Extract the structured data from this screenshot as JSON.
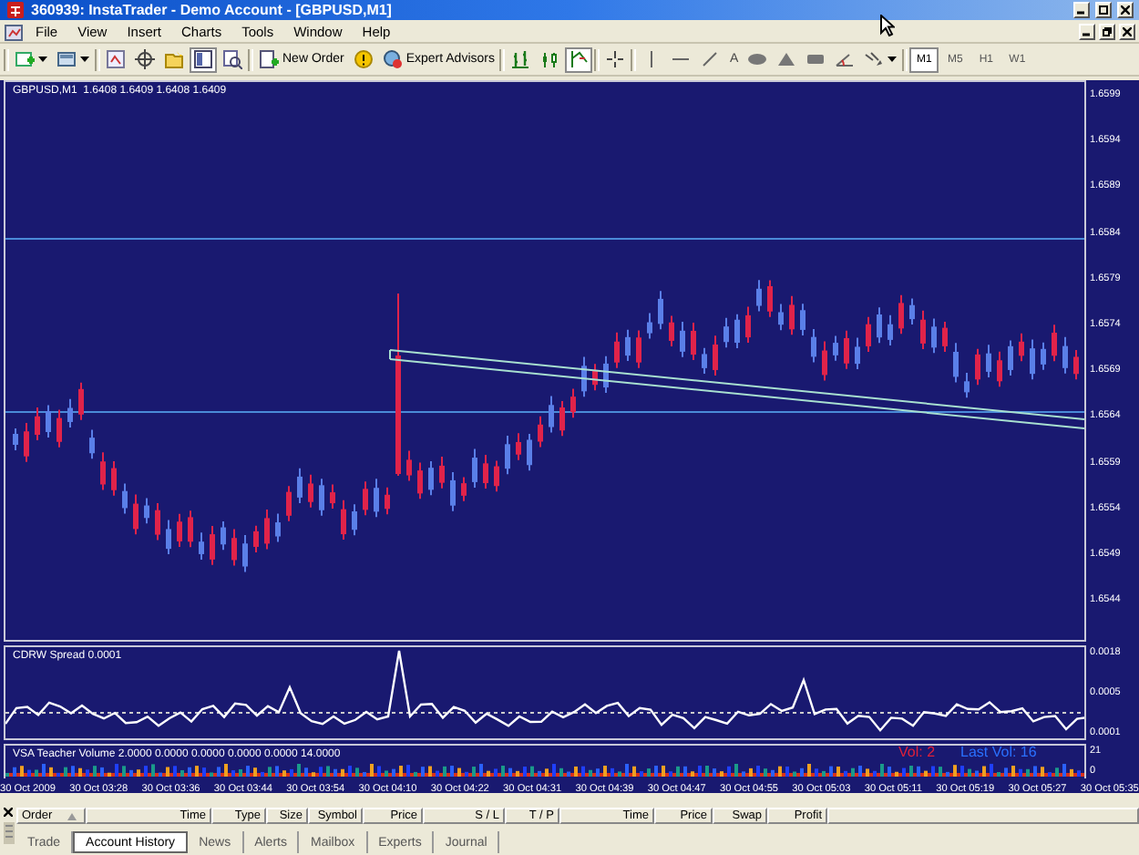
{
  "window": {
    "title": "360939: InstaTrader - Demo Account - [GBPUSD,M1]"
  },
  "menu": [
    "File",
    "View",
    "Insert",
    "Charts",
    "Tools",
    "Window",
    "Help"
  ],
  "toolbar": {
    "new_order": "New Order",
    "expert_advisors": "Expert Advisors",
    "text_tool": "A",
    "timeframes": [
      {
        "label": "M1",
        "selected": true
      },
      {
        "label": "M5",
        "selected": false
      },
      {
        "label": "H1",
        "selected": false
      },
      {
        "label": "W1",
        "selected": false
      }
    ]
  },
  "chart": {
    "legend": "GBPUSD,M1  1.6408 1.6409 1.6408 1.6409",
    "price_axis": [
      "1.6599",
      "1.6594",
      "1.6589",
      "1.6584",
      "1.6579",
      "1.6574",
      "1.6569",
      "1.6564",
      "1.6559",
      "1.6554",
      "1.6549",
      "1.6544"
    ],
    "spread": {
      "title": "CDRW Spread 0.0001",
      "axis": [
        "0.0018",
        "0.0005",
        "0.0001"
      ]
    },
    "volume": {
      "title": "VSA Teacher Volume 2.0000 0.0000 0.0000 0.0000 0.0000 14.0000",
      "vol": "Vol: 2",
      "last_vol": "Last Vol: 16",
      "axis": [
        "21",
        "0"
      ]
    },
    "time_axis": [
      "30 Oct 2009",
      "30 Oct 03:28",
      "30 Oct 03:36",
      "30 Oct 03:44",
      "30 Oct 03:54",
      "30 Oct 04:10",
      "30 Oct 04:22",
      "30 Oct 04:31",
      "30 Oct 04:39",
      "30 Oct 04:47",
      "30 Oct 04:55",
      "30 Oct 05:03",
      "30 Oct 05:11",
      "30 Oct 05:19",
      "30 Oct 05:27",
      "30 Oct 05:35"
    ]
  },
  "terminal": {
    "columns": [
      {
        "label": "Order",
        "sorted": true
      },
      {
        "label": "Time",
        "sorted": false
      },
      {
        "label": "Type",
        "sorted": false
      },
      {
        "label": "Size",
        "sorted": false
      },
      {
        "label": "Symbol",
        "sorted": false
      },
      {
        "label": "Price",
        "sorted": false
      },
      {
        "label": "S / L",
        "sorted": false
      },
      {
        "label": "T / P",
        "sorted": false
      },
      {
        "label": "Time",
        "sorted": false
      },
      {
        "label": "Price",
        "sorted": false
      },
      {
        "label": "Swap",
        "sorted": false
      },
      {
        "label": "Profit",
        "sorted": false
      }
    ],
    "tabs": [
      {
        "label": "Trade",
        "selected": false
      },
      {
        "label": "Account History",
        "selected": true
      },
      {
        "label": "News",
        "selected": false
      },
      {
        "label": "Alerts",
        "selected": false
      },
      {
        "label": "Mailbox",
        "selected": false
      },
      {
        "label": "Experts",
        "selected": false
      },
      {
        "label": "Journal",
        "selected": false
      }
    ]
  }
}
